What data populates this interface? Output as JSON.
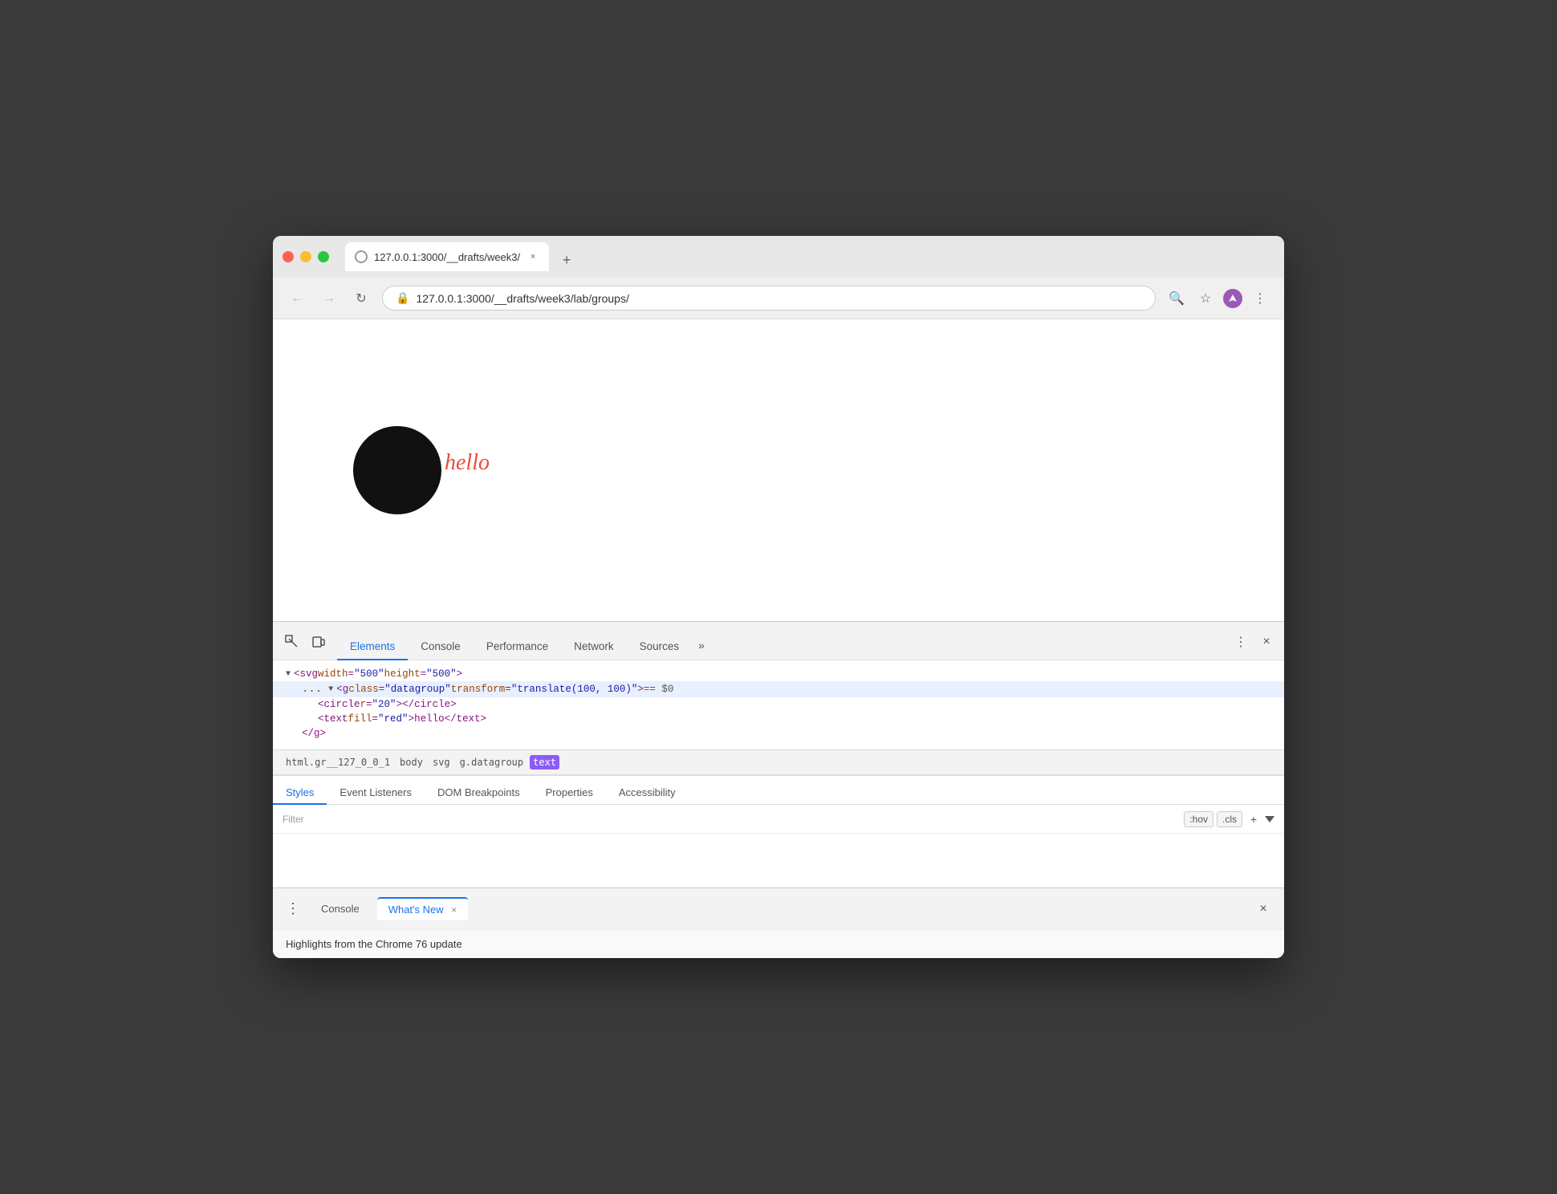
{
  "browser": {
    "tab_title": "127.0.0.1:3000/__drafts/week3/",
    "url": "127.0.0.1:3000/__drafts/week3/lab/groups/",
    "new_tab_label": "+"
  },
  "nav": {
    "back_label": "←",
    "forward_label": "→",
    "reload_label": "↻"
  },
  "webpage": {
    "circle_text": "hello"
  },
  "devtools": {
    "tabs": [
      {
        "label": "Elements",
        "active": true
      },
      {
        "label": "Console",
        "active": false
      },
      {
        "label": "Performance",
        "active": false
      },
      {
        "label": "Network",
        "active": false
      },
      {
        "label": "Sources",
        "active": false
      }
    ],
    "more_label": "»",
    "html_lines": [
      {
        "indent": 1,
        "content": "▼<svg width=\"500\" height=\"500\">",
        "id": "svg-line"
      },
      {
        "indent": 2,
        "content": "▼<g class=\"datagroup\" transform=\"translate(100, 100)\"> == $0",
        "id": "g-line",
        "selected": true
      },
      {
        "indent": 3,
        "content": "<circle r=\"20\"></circle>",
        "id": "circle-line"
      },
      {
        "indent": 3,
        "content": "<text fill=\"red\">hello</text>",
        "id": "text-line"
      },
      {
        "indent": 2,
        "content": "</g>",
        "id": "close-g-line"
      }
    ],
    "dots_label": "...",
    "breadcrumb": [
      {
        "label": "html.gr__127_0_0_1",
        "highlighted": false
      },
      {
        "label": "body",
        "highlighted": false
      },
      {
        "label": "svg",
        "highlighted": false
      },
      {
        "label": "g.datagroup",
        "highlighted": false
      },
      {
        "label": "text",
        "highlighted": true
      }
    ],
    "styles_tabs": [
      {
        "label": "Styles",
        "active": true
      },
      {
        "label": "Event Listeners",
        "active": false
      },
      {
        "label": "DOM Breakpoints",
        "active": false
      },
      {
        "label": "Properties",
        "active": false
      },
      {
        "label": "Accessibility",
        "active": false
      }
    ],
    "filter_placeholder": "Filter",
    "filter_hov": ":hov",
    "filter_cls": ".cls",
    "filter_plus": "+"
  },
  "bottom_bar": {
    "dots_label": "⋮",
    "console_label": "Console",
    "whats_new_label": "What's New",
    "close_label": "×"
  },
  "highlights": {
    "text": "Highlights from the Chrome 76 update"
  }
}
